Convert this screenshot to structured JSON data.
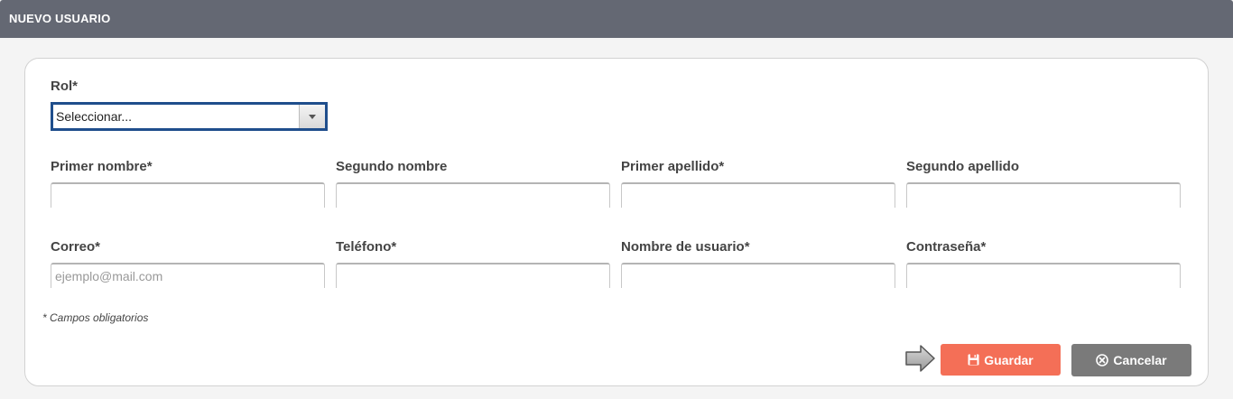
{
  "header": {
    "title": "NUEVO USUARIO"
  },
  "form": {
    "rol": {
      "label": "Rol*",
      "selected": "Seleccionar..."
    },
    "fields": [
      {
        "label": "Primer nombre*",
        "value": "",
        "placeholder": ""
      },
      {
        "label": "Segundo nombre",
        "value": "",
        "placeholder": ""
      },
      {
        "label": "Primer apellido*",
        "value": "",
        "placeholder": ""
      },
      {
        "label": "Segundo apellido",
        "value": "",
        "placeholder": ""
      },
      {
        "label": "Correo*",
        "value": "",
        "placeholder": "ejemplo@mail.com"
      },
      {
        "label": "Teléfono*",
        "value": "",
        "placeholder": ""
      },
      {
        "label": "Nombre de usuario*",
        "value": "",
        "placeholder": ""
      },
      {
        "label": "Contraseña*",
        "value": "",
        "placeholder": ""
      }
    ],
    "required_note": "* Campos obligatorios"
  },
  "actions": {
    "save_label": "Guardar",
    "save_icon": "floppy-disk-icon",
    "save_color": "#f46f57",
    "cancel_label": "Cancelar",
    "cancel_icon": "circle-x-icon",
    "cancel_color": "#7a7a7a",
    "pointer_icon": "arrow-right-icon"
  }
}
